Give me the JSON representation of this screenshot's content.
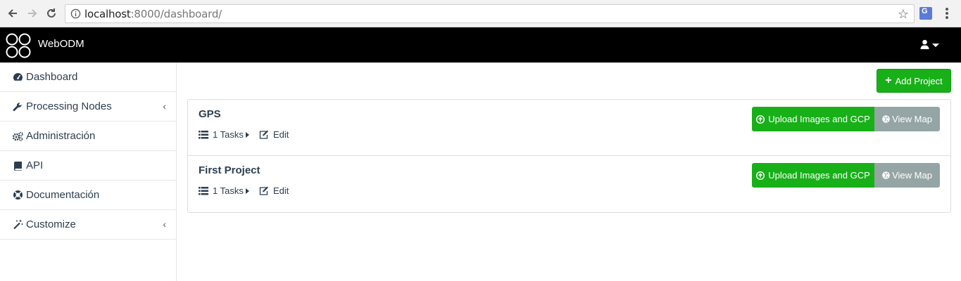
{
  "browser": {
    "url_host": "localhost",
    "url_rest": ":8000/dashboard/"
  },
  "header": {
    "brand": "WebODM"
  },
  "sidebar": {
    "items": [
      {
        "label": "Dashboard",
        "icon": "dashboard-icon"
      },
      {
        "label": "Processing Nodes",
        "icon": "wrench-icon",
        "chevron": "‹"
      },
      {
        "label": "Administración",
        "icon": "gears-icon"
      },
      {
        "label": "API",
        "icon": "book-icon"
      },
      {
        "label": "Documentación",
        "icon": "lifesaver-icon"
      },
      {
        "label": "Customize",
        "icon": "magic-wand-icon",
        "chevron": "‹"
      }
    ]
  },
  "main": {
    "add_project_label": "Add Project",
    "projects": [
      {
        "name": "GPS",
        "tasks_label": "1 Tasks",
        "edit_label": "Edit",
        "upload_label": "Upload Images and GCP",
        "view_map_label": "View Map"
      },
      {
        "name": "First Project",
        "tasks_label": "1 Tasks",
        "edit_label": "Edit",
        "upload_label": "Upload Images and GCP",
        "view_map_label": "View Map"
      }
    ]
  },
  "colors": {
    "topbar": "#000000",
    "success": "#18b018",
    "gray_button": "#95a5a6",
    "text": "#2c3e50"
  }
}
